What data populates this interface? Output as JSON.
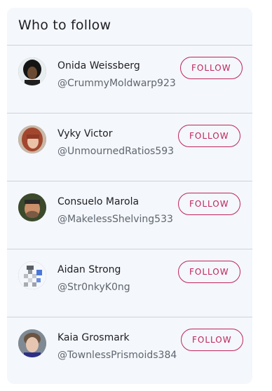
{
  "widget": {
    "title": "Who to follow",
    "follow_label": "FOLLOW"
  },
  "users": [
    {
      "name": "Onida Weissberg",
      "handle": "@CrummyMoldwarp923"
    },
    {
      "name": "Vyky Victor",
      "handle": "@UnmournedRatios593"
    },
    {
      "name": "Consuelo Marola",
      "handle": "@MakelessShelving533"
    },
    {
      "name": "Aidan Strong",
      "handle": "@Str0nkyK0ng"
    },
    {
      "name": "Kaia Grosmark",
      "handle": "@TownlessPrismoids384"
    }
  ],
  "colors": {
    "card_background": "#f4f7fb",
    "accent": "#c0245c",
    "divider": "#cfd4da"
  }
}
